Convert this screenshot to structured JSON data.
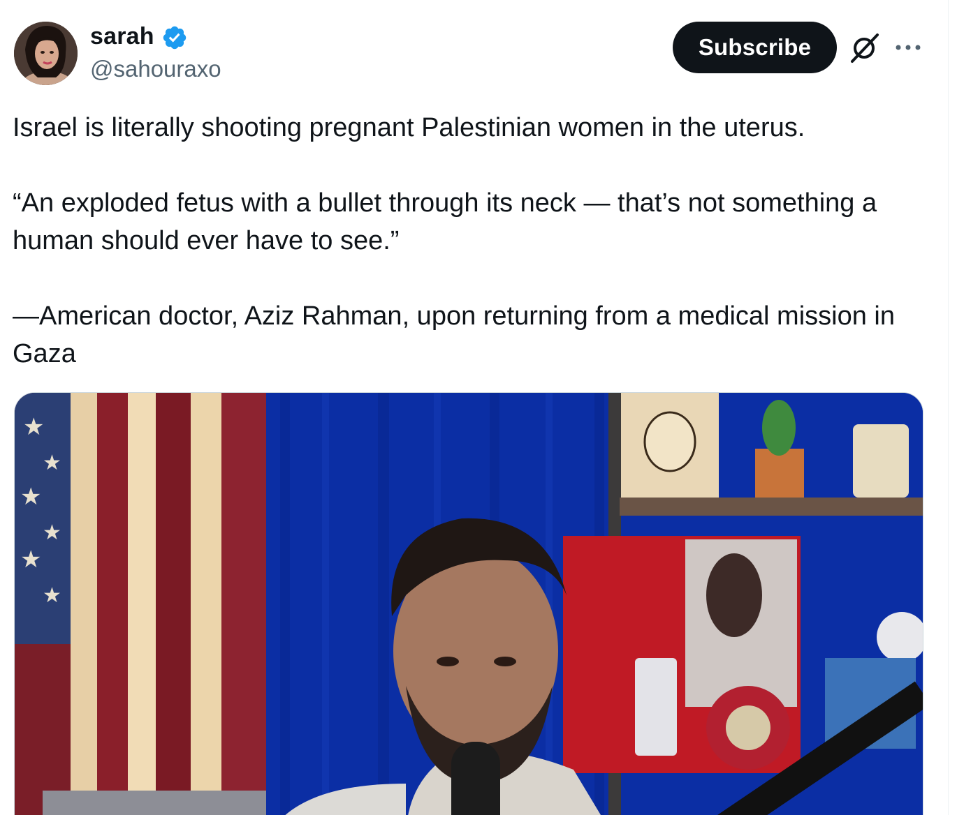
{
  "author": {
    "display_name": "sarah",
    "handle": "@sahouraxo",
    "verified": true
  },
  "header_actions": {
    "subscribe_label": "Subscribe",
    "grok_icon": "grok-icon",
    "more_icon": "more-icon"
  },
  "tweet": {
    "paragraphs": [
      "Israel is literally shooting pregnant Palestinian women in the uterus.",
      "“An exploded fetus with a bullet through its neck — that’s not something a human should ever have to see.”",
      "—American doctor, Aziz Rahman, upon returning from a medical mission in Gaza"
    ]
  },
  "colors": {
    "text": "#0f1419",
    "secondary": "#536471",
    "verified_blue": "#1d9bf0",
    "button_bg": "#0f1419"
  }
}
